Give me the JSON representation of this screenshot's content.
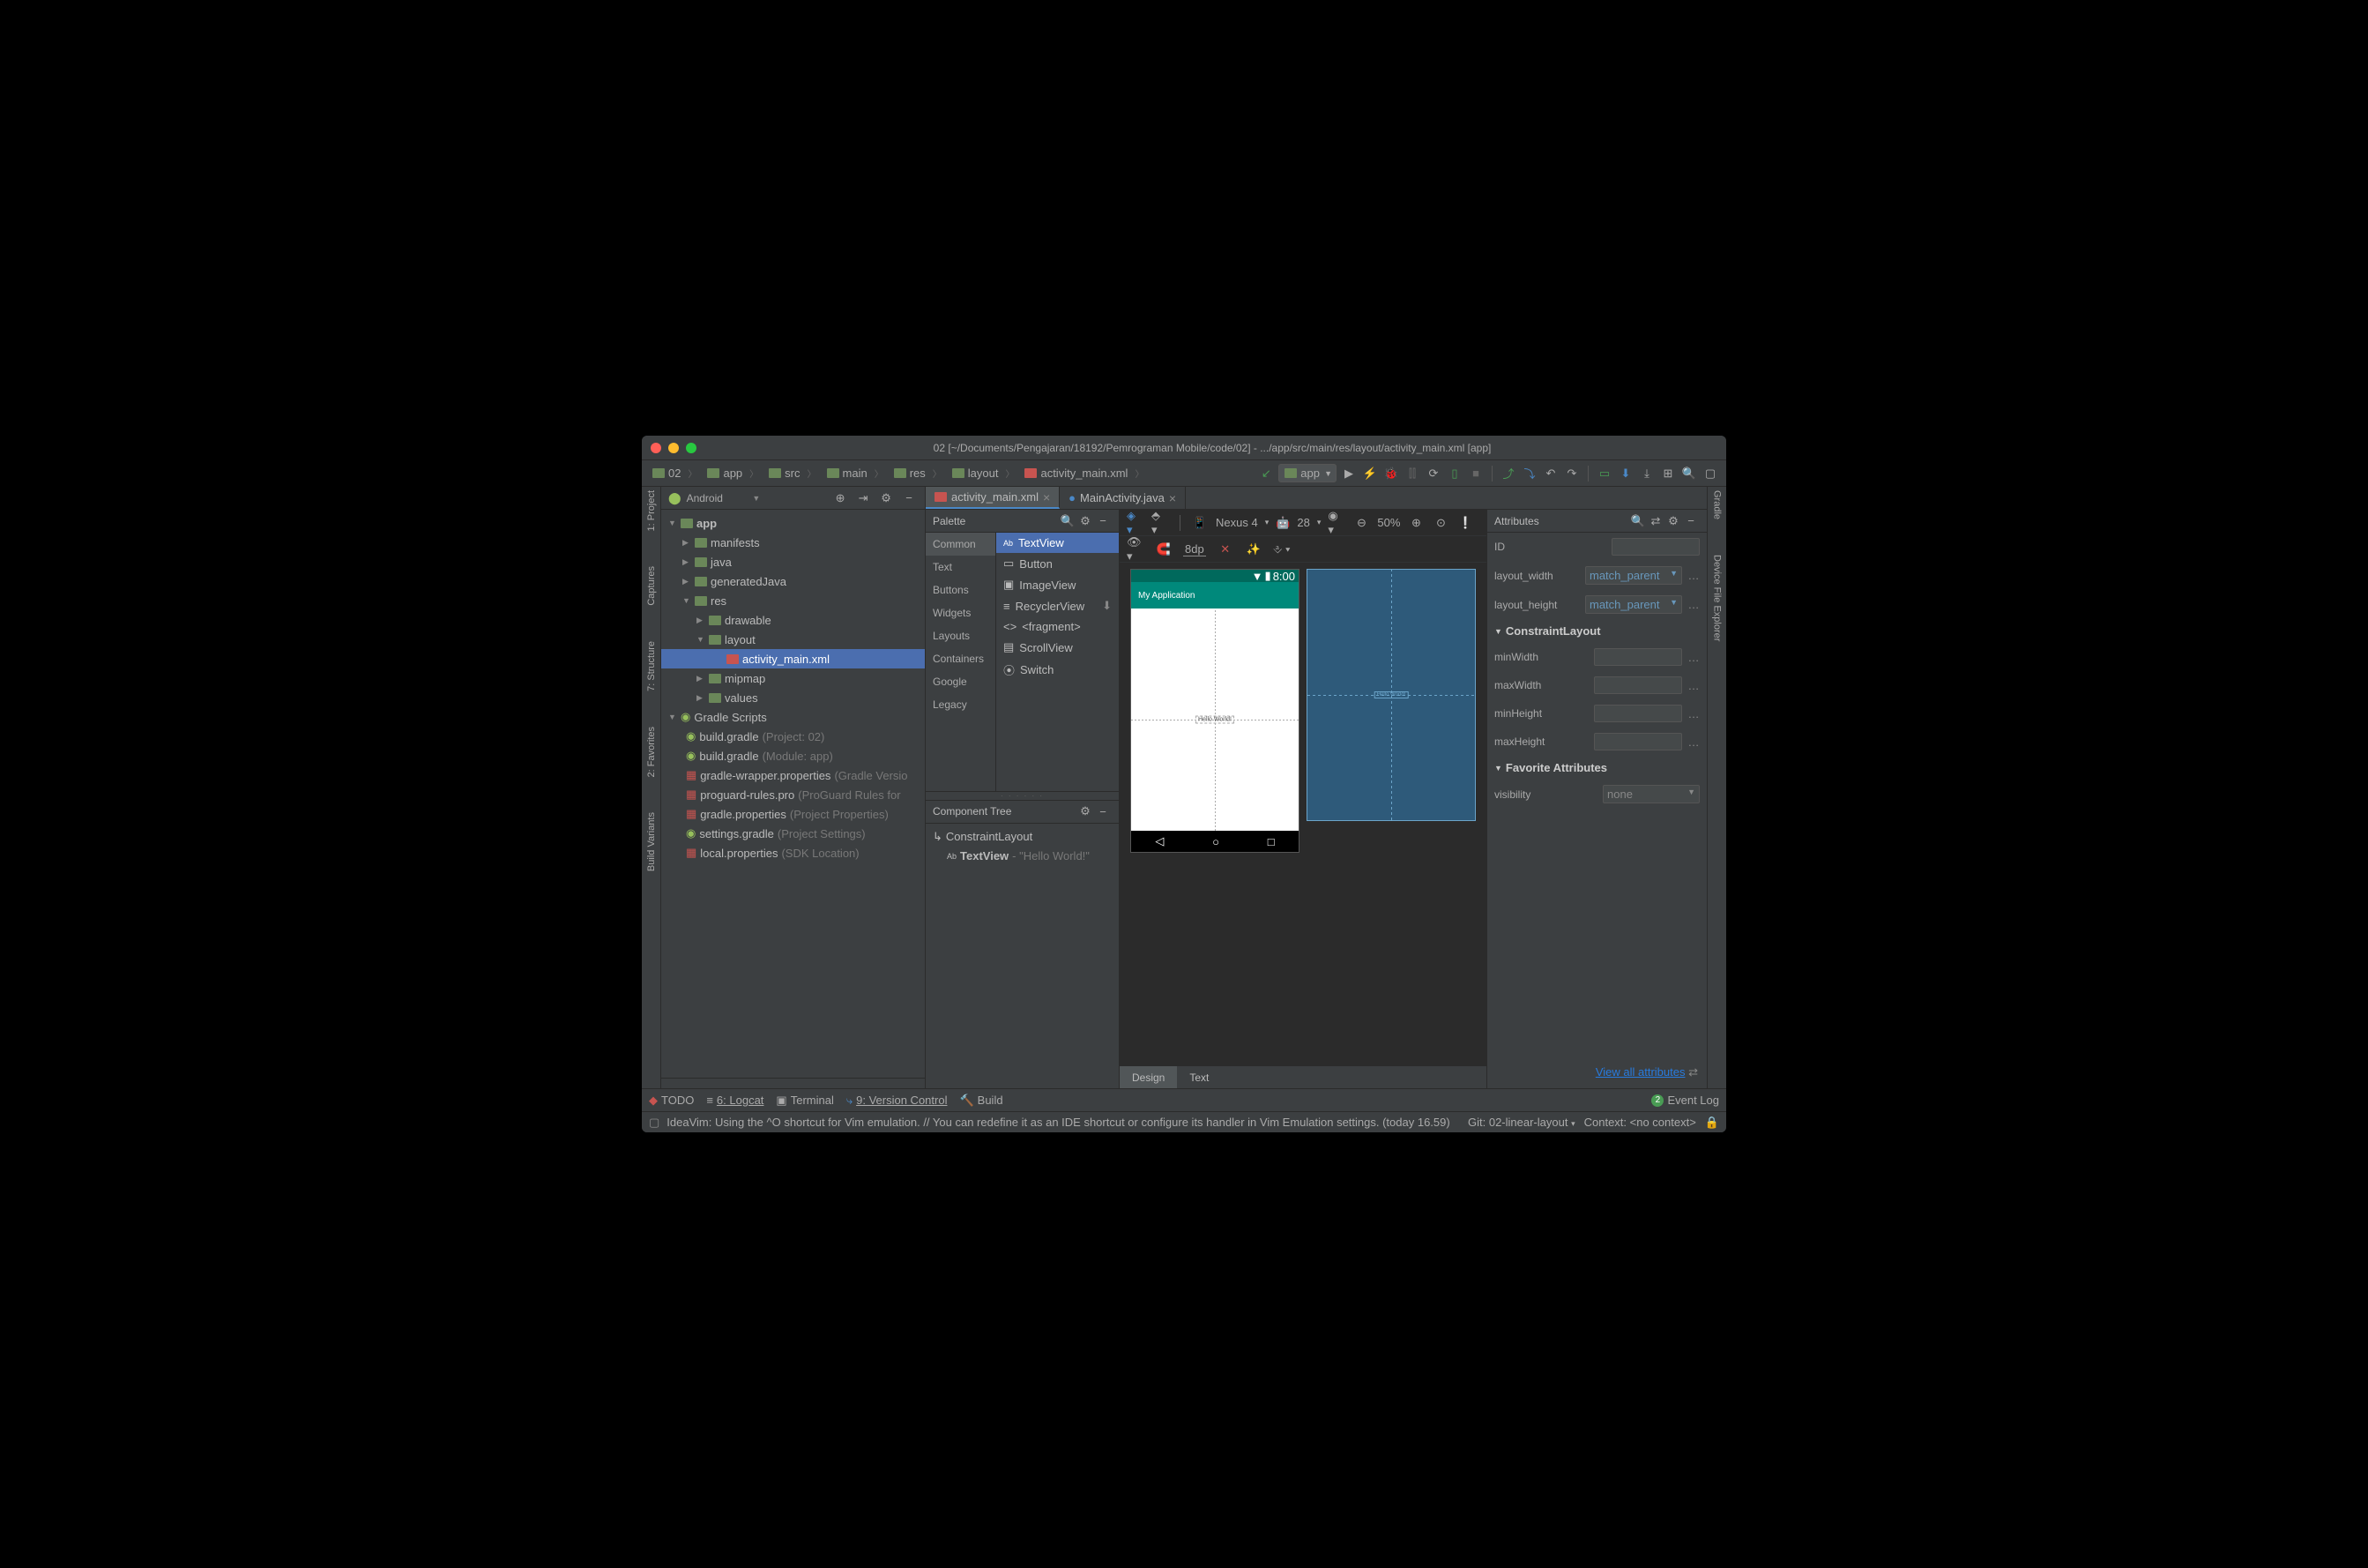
{
  "title": "02 [~/Documents/Pengajaran/18192/Pemrograman Mobile/code/02] - .../app/src/main/res/layout/activity_main.xml [app]",
  "breadcrumbs": [
    "02",
    "app",
    "src",
    "main",
    "res",
    "layout",
    "activity_main.xml"
  ],
  "run_config": "app",
  "left_rail": [
    "1: Project",
    "Captures",
    "7: Structure",
    "2: Favorites",
    "Build Variants"
  ],
  "right_rail": [
    "Gradle",
    "Device File Explorer"
  ],
  "project_header": "Android",
  "tree": {
    "app": "app",
    "manifests": "manifests",
    "java": "java",
    "generatedJava": "generatedJava",
    "res": "res",
    "drawable": "drawable",
    "layout": "layout",
    "activity_main": "activity_main.xml",
    "mipmap": "mipmap",
    "values": "values",
    "gradle_scripts": "Gradle Scripts",
    "bg_project": "build.gradle",
    "bg_project_hint": " (Project: 02)",
    "bg_module": "build.gradle",
    "bg_module_hint": " (Module: app)",
    "gwrap": "gradle-wrapper.properties",
    "gwrap_hint": " (Gradle Versio",
    "proguard": "proguard-rules.pro",
    "proguard_hint": " (ProGuard Rules for",
    "gprops": "gradle.properties",
    "gprops_hint": " (Project Properties)",
    "settings": "settings.gradle",
    "settings_hint": " (Project Settings)",
    "local": "local.properties",
    "local_hint": " (SDK Location)"
  },
  "tabs": [
    {
      "label": "activity_main.xml",
      "active": true
    },
    {
      "label": "MainActivity.java",
      "active": false
    }
  ],
  "palette_title": "Palette",
  "palette_cats": [
    "Common",
    "Text",
    "Buttons",
    "Widgets",
    "Layouts",
    "Containers",
    "Google",
    "Legacy"
  ],
  "palette_items": [
    "TextView",
    "Button",
    "ImageView",
    "RecyclerView",
    "<fragment>",
    "ScrollView",
    "Switch"
  ],
  "comp_tree_title": "Component Tree",
  "comp_root": "ConstraintLayout",
  "comp_child_prefix": "TextView",
  "comp_child_suffix": "- \"Hello World!\"",
  "design_toolbar": {
    "device": "Nexus 4",
    "api": "28",
    "zoom": "50%",
    "dp": "8dp"
  },
  "phone": {
    "time": "8:00",
    "app_title": "My Application",
    "hello": "Hello World!"
  },
  "attrs": {
    "title": "Attributes",
    "id": "ID",
    "layout_width": "layout_width",
    "layout_width_val": "match_parent",
    "layout_height": "layout_height",
    "layout_height_val": "match_parent",
    "cl": "ConstraintLayout",
    "minWidth": "minWidth",
    "maxWidth": "maxWidth",
    "minHeight": "minHeight",
    "maxHeight": "maxHeight",
    "fav": "Favorite Attributes",
    "visibility": "visibility",
    "visibility_val": "none",
    "view_all": "View all attributes"
  },
  "bottom_tabs": [
    "Design",
    "Text"
  ],
  "status_bar": {
    "todo": "TODO",
    "logcat": "6: Logcat",
    "terminal": "Terminal",
    "vcs": "9: Version Control",
    "build": "Build",
    "event_log": "Event Log",
    "event_count": "2"
  },
  "status_msg": "IdeaVim: Using the ^O shortcut for Vim emulation. // You can redefine it as an IDE shortcut or configure its handler in Vim Emulation settings. (today 16.59)",
  "git": "Git: 02-linear-layout",
  "context": "Context: <no context>"
}
